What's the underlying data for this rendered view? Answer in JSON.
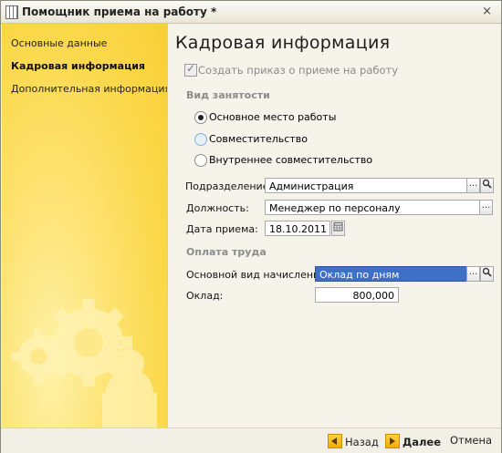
{
  "window": {
    "title": "Помощник приема на работу *",
    "close_glyph": "×"
  },
  "sidebar": {
    "items": [
      {
        "label": "Основные данные"
      },
      {
        "label": "Кадровая информация"
      },
      {
        "label": "Дополнительная информация"
      }
    ]
  },
  "main": {
    "heading": "Кадровая информация",
    "create_order": {
      "label": "Создать приказ о приеме на работу",
      "checked": true
    },
    "employment": {
      "section_label": "Вид занятости",
      "options": [
        {
          "label": "Основное место работы",
          "selected": true
        },
        {
          "label": "Совместительство",
          "selected": false
        },
        {
          "label": "Внутреннее совместительство",
          "selected": false
        }
      ]
    },
    "department": {
      "label": "Подразделение:",
      "value": "Администрация"
    },
    "position": {
      "label": "Должность:",
      "value": "Менеджер по персоналу"
    },
    "hire_date": {
      "label": "Дата приема:",
      "value": "18.10.2011"
    },
    "payment": {
      "section_label": "Оплата труда",
      "accrual_type": {
        "label": "Основной вид начисления:",
        "value": "Оклад по дням"
      },
      "salary": {
        "label": "Оклад:",
        "value": "800,000"
      }
    },
    "select_button_glyph": "...",
    "search_icon": "magnifier-icon"
  },
  "footer": {
    "back_label": "Назад",
    "next_label": "Далее",
    "cancel_label": "Отмена"
  },
  "colors": {
    "sidebar_accent": "#fbd84a",
    "selection": "#3f70c8",
    "nav_arrow": "#f3a90c"
  }
}
